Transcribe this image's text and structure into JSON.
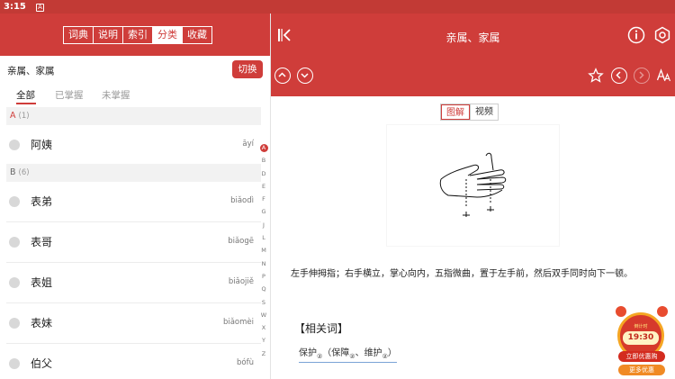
{
  "status_bar": {
    "time": "3:15",
    "notification_icon": "A"
  },
  "left": {
    "header_tabs": [
      {
        "label": "词典",
        "active": false
      },
      {
        "label": "说明",
        "active": false
      },
      {
        "label": "索引",
        "active": false
      },
      {
        "label": "分类",
        "active": true
      },
      {
        "label": "收藏",
        "active": false
      }
    ],
    "category_title": "亲属、家属",
    "switch_label": "切换",
    "filter_tabs": [
      {
        "label": "全部",
        "active": true
      },
      {
        "label": "已掌握",
        "active": false
      },
      {
        "label": "未掌握",
        "active": false
      }
    ],
    "groups": [
      {
        "letter": "A",
        "count": "(1)",
        "items": [
          {
            "word": "阿姨",
            "pinyin": "āyí"
          }
        ]
      },
      {
        "letter": "B",
        "count": "(6)",
        "items": [
          {
            "word": "表弟",
            "pinyin": "biǎodì"
          },
          {
            "word": "表哥",
            "pinyin": "biǎogē"
          },
          {
            "word": "表姐",
            "pinyin": "biǎojiě"
          },
          {
            "word": "表妹",
            "pinyin": "biǎomèi"
          },
          {
            "word": "伯父",
            "pinyin": "bófù"
          }
        ]
      }
    ],
    "alphabet": [
      "A",
      "B",
      "D",
      "E",
      "F",
      "G",
      "J",
      "L",
      "M",
      "N",
      "P",
      "Q",
      "S",
      "W",
      "X",
      "Y",
      "Z"
    ],
    "alphabet_active": "A"
  },
  "right": {
    "title": "亲属、家属",
    "view_tabs": [
      {
        "label": "图解",
        "active": true
      },
      {
        "label": "视频",
        "active": false
      }
    ],
    "description": "左手伸拇指；右手横立，掌心向内，五指微曲，置于左手前，然后双手同时向下一顿。",
    "related_title": "【相关词】",
    "related_main": "保护",
    "related_main_sub": "②",
    "related_paren_open": "（",
    "related_a": "保障",
    "related_a_sub": "②",
    "related_sep": "、",
    "related_b": "维护",
    "related_b_sub": "②",
    "related_paren_close": "）",
    "icons": {
      "collapse": "collapse-sidebar-icon",
      "info": "info-icon",
      "settings": "settings-icon",
      "up": "chevron-up-icon",
      "down": "chevron-down-icon",
      "star": "star-icon",
      "prev": "chevron-left-icon",
      "next": "chevron-right-icon",
      "font": "font-size-icon"
    }
  },
  "promo": {
    "label": "倒计时",
    "time": "19:30",
    "button_primary": "立即优惠购",
    "button_secondary": "更多优惠"
  },
  "colors": {
    "accent": "#cf3d3a",
    "status_bar": "#c23a35"
  }
}
